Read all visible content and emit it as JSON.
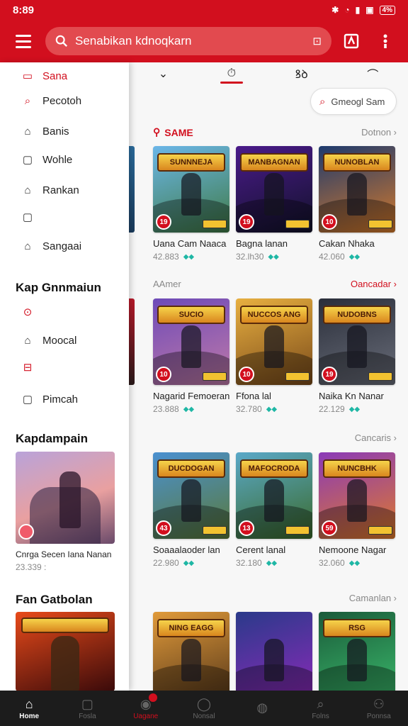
{
  "status": {
    "time": "8:89",
    "battery": "4%"
  },
  "appbar": {
    "search_text": "Senabikan kdnoqkarn"
  },
  "tabs": [
    {
      "label": "⌄"
    },
    {
      "label": "⏱"
    },
    {
      "label": "ꝸꝺ"
    },
    {
      "label": "⌒"
    }
  ],
  "search_chip": {
    "label": "Gmeogl Sam"
  },
  "sections": [
    {
      "title": "SAME",
      "more": "Dotnon ›"
    },
    {
      "title": "AAmer",
      "more": "Oancadar ›"
    },
    {
      "title": "",
      "more": "Cancaris ›"
    },
    {
      "title": "",
      "more": "Camanlan ›"
    }
  ],
  "rows": [
    [
      {
        "logo": "SUNNNEJA",
        "badge": "19",
        "name": "Uana Cam Naaca",
        "meta": "42.883",
        "colors": [
          "#6bb6e8",
          "#3f7a45"
        ]
      },
      {
        "logo": "MANBAGNAN",
        "badge": "19",
        "name": "Bagna lanan",
        "meta": "32.lh30",
        "colors": [
          "#4a1a8a",
          "#12122a"
        ]
      },
      {
        "logo": "NUNOBLAN",
        "badge": "10",
        "name": "Cakan Nhaka",
        "meta": "42.060",
        "colors": [
          "#1d3a6e",
          "#d67a2a"
        ]
      }
    ],
    [
      {
        "logo": "SUCIO",
        "badge": "10",
        "name": "Nagarid Femoeran",
        "meta": "23.888",
        "colors": [
          "#6d4ab8",
          "#c07aa8"
        ]
      },
      {
        "logo": "NUCCOS ANG",
        "badge": "10",
        "name": "Ffona lal",
        "meta": "32.780",
        "colors": [
          "#e8b040",
          "#7a4a1a"
        ]
      },
      {
        "logo": "NUDOBNS",
        "badge": "19",
        "name": "Naika Kn Nanar",
        "meta": "22.129",
        "colors": [
          "#2a2e3a",
          "#6a6e7a"
        ]
      }
    ],
    [
      {
        "logo": "DUCDOGAN",
        "badge": "43",
        "name": "Soaaalaoder lan",
        "meta": "22.980",
        "colors": [
          "#4a90d0",
          "#5a7a3a"
        ]
      },
      {
        "logo": "MAFOCRODA",
        "badge": "13",
        "name": "Cerent lanal",
        "meta": "32.180",
        "colors": [
          "#5aa8c8",
          "#3a6a2a"
        ]
      },
      {
        "logo": "NUNCBHK",
        "badge": "59",
        "name": "Nemoone Nagar",
        "meta": "32.060",
        "colors": [
          "#8a3ab8",
          "#e07a2a"
        ]
      }
    ],
    [
      {
        "logo": "NING EAGG",
        "badge": "",
        "name": "",
        "meta": "",
        "colors": [
          "#e09a3a",
          "#5a3a1a"
        ]
      },
      {
        "logo": "",
        "badge": "",
        "name": "",
        "meta": "",
        "colors": [
          "#2a3a8a",
          "#8a2ab8"
        ]
      },
      {
        "logo": "RSG",
        "badge": "",
        "name": "",
        "meta": "",
        "colors": [
          "#1a5a3a",
          "#3ab86a"
        ]
      }
    ]
  ],
  "drawer": {
    "items": [
      {
        "label": "Sana",
        "icon": "▭",
        "active": true
      },
      {
        "label": "Pecotoh",
        "icon": "⌕",
        "active": false
      },
      {
        "label": "Banis",
        "icon": "⌂",
        "active": false
      },
      {
        "label": "Wohle",
        "icon": "▢",
        "active": false
      },
      {
        "label": "Rankan",
        "icon": "⌂",
        "active": false
      },
      {
        "label": "",
        "icon": "▢",
        "active": false
      },
      {
        "label": "Sangaai",
        "icon": "⌂",
        "active": false
      }
    ],
    "heading1": "Kap Gnnmaiun",
    "items2": [
      {
        "label": "",
        "icon": "⊙",
        "red": true
      },
      {
        "label": "Moocal",
        "icon": "⌂",
        "red": false
      },
      {
        "label": "",
        "icon": "⊟",
        "red": true
      },
      {
        "label": "Pimcah",
        "icon": "▢",
        "red": false
      }
    ],
    "heading2": "Kapdampain",
    "card1": {
      "name": "Cnrga Secen Iana Nanan",
      "meta": "23.339 :"
    },
    "heading3": "Fan Gatbolan",
    "card2": {
      "name": ""
    }
  },
  "bottomnav": [
    {
      "label": "Home",
      "icon": "⌂",
      "active": true
    },
    {
      "label": "Fosla",
      "icon": "▢",
      "active": false
    },
    {
      "label": "Uagane",
      "icon": "◉",
      "active": false,
      "red": true
    },
    {
      "label": "Nonsal",
      "icon": "◯",
      "active": false
    },
    {
      "label": "",
      "icon": "◍",
      "active": false
    },
    {
      "label": "Folns",
      "icon": "⌕",
      "active": false
    },
    {
      "label": "Ponnsa",
      "icon": "⚇",
      "active": false
    }
  ],
  "colors": {
    "brand": "#d20f1e",
    "navbg": "#1c1c1c"
  }
}
